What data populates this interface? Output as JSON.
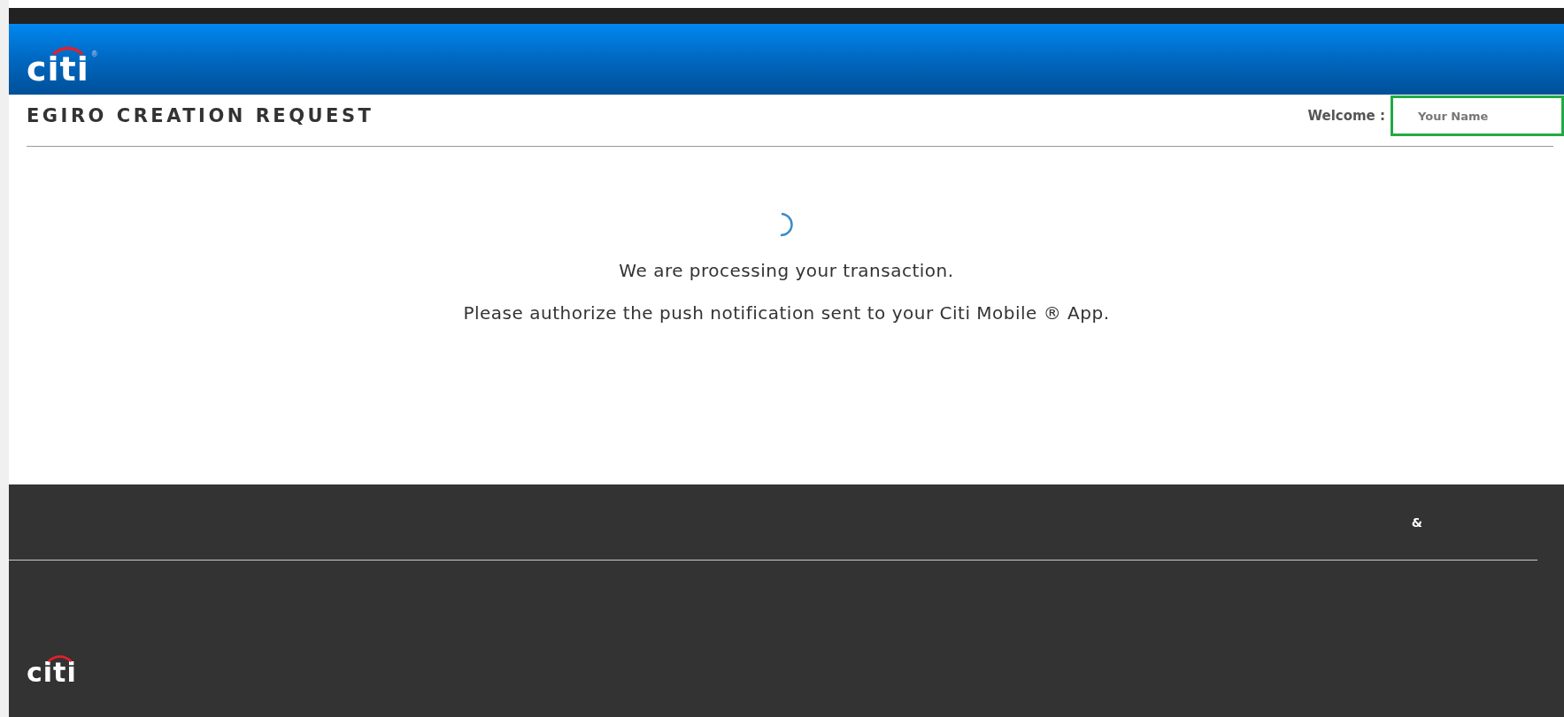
{
  "header": {
    "logo": "citi",
    "logo_mark": "®"
  },
  "page_title": "EGIRO CREATION REQUEST",
  "welcome": {
    "label": "Welcome :",
    "placeholder": "Your Name"
  },
  "status": {
    "messages": [
      "We are processing your transaction.",
      "Please authorize the push notification sent to your Citi Mobile ® App."
    ]
  },
  "footer": {
    "symbol": "&",
    "logo": "citi"
  }
}
